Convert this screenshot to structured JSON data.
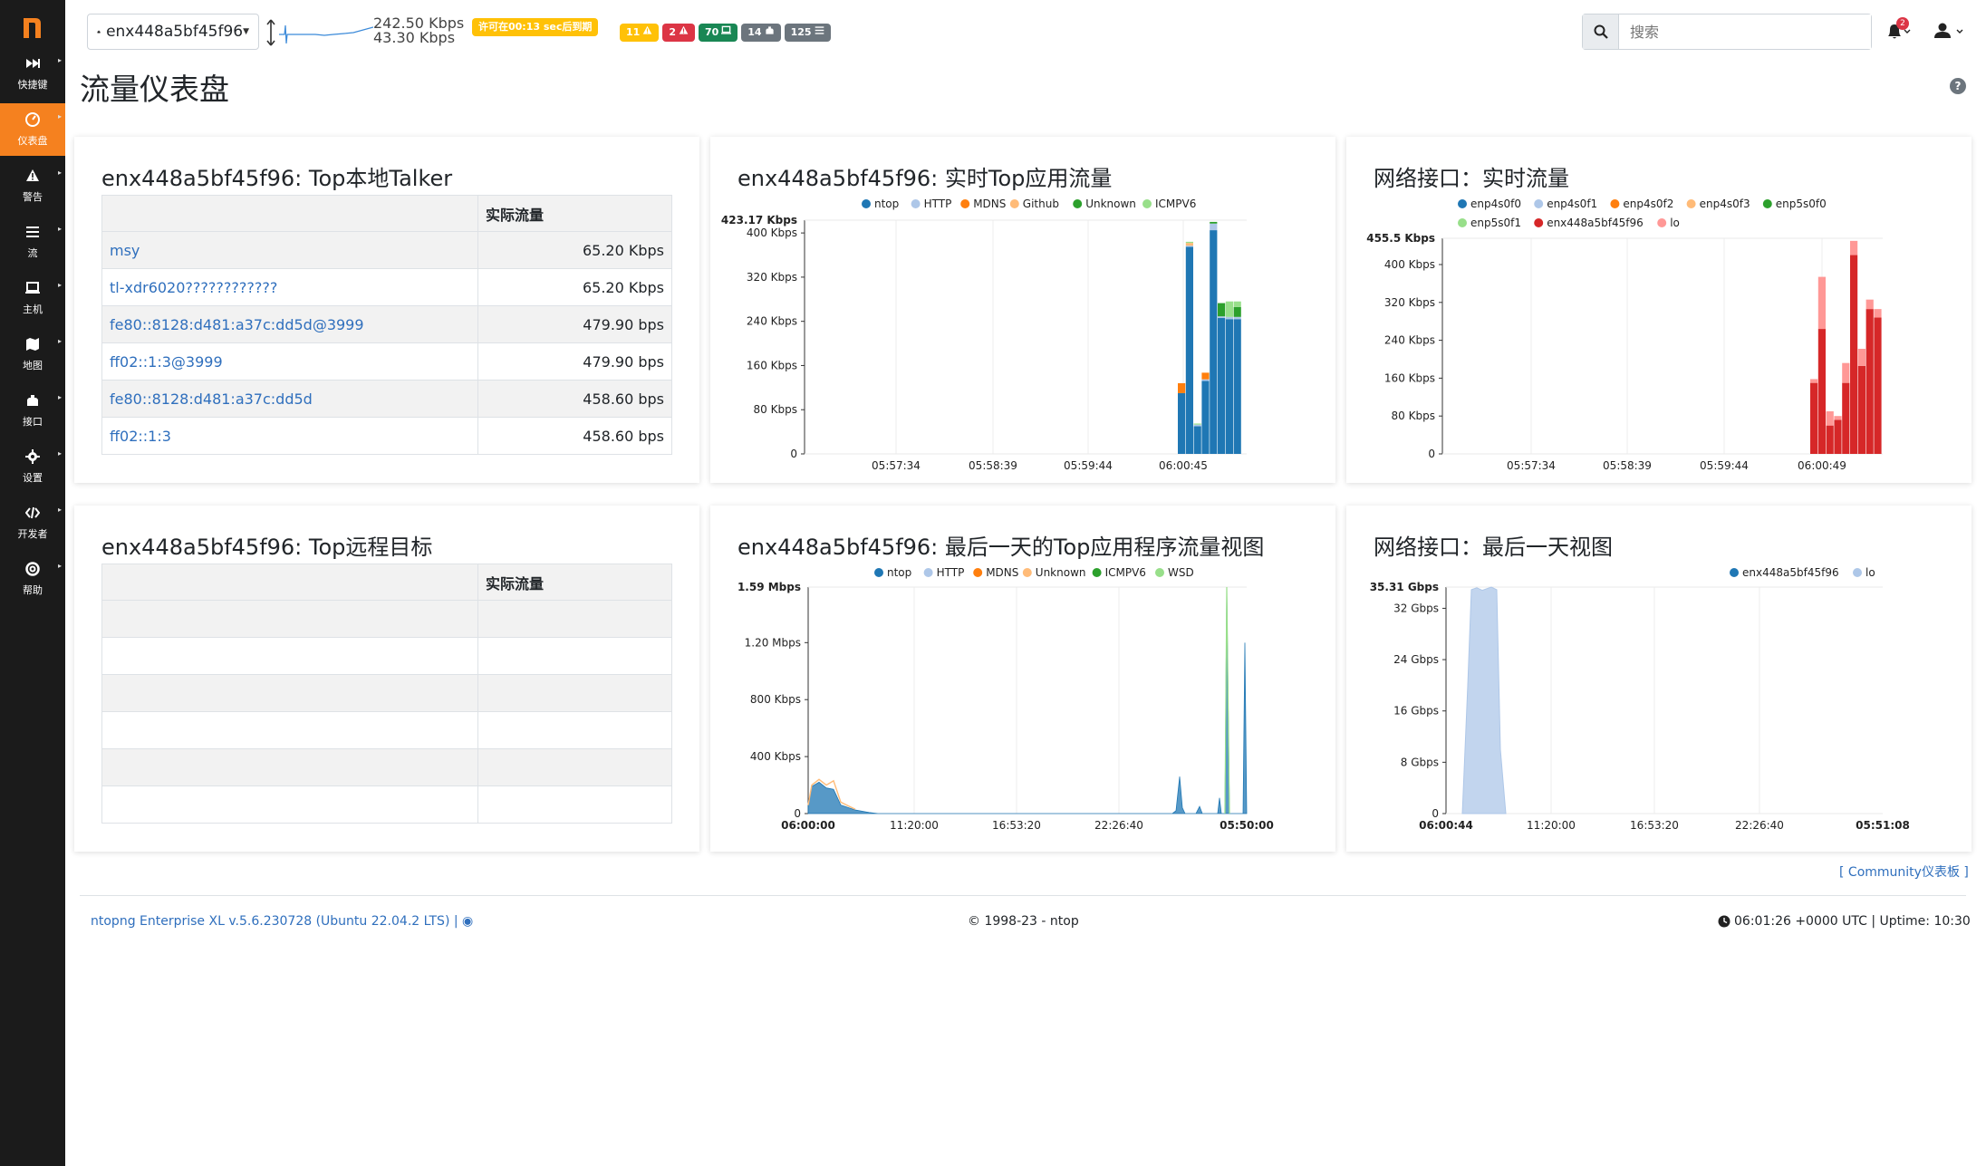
{
  "sidebar": {
    "items": [
      {
        "label": "快捷键",
        "icon": "fast-forward-icon"
      },
      {
        "label": "仪表盘",
        "icon": "dashboard-gauge-icon"
      },
      {
        "label": "警告",
        "icon": "warning-icon"
      },
      {
        "label": "流",
        "icon": "flows-list-icon"
      },
      {
        "label": "主机",
        "icon": "laptop-icon"
      },
      {
        "label": "地图",
        "icon": "map-icon"
      },
      {
        "label": "接口",
        "icon": "ethernet-icon"
      },
      {
        "label": "设置",
        "icon": "gear-icon"
      },
      {
        "label": "开发者",
        "icon": "code-icon"
      },
      {
        "label": "帮助",
        "icon": "lifebuoy-icon"
      }
    ],
    "active_index": 1
  },
  "topbar": {
    "interface": "enx448a5bf45f96",
    "rate_up": "242.50 Kbps",
    "rate_down": "43.30 Kbps",
    "license_warning": "许可在00:13 sec后到期",
    "badges": [
      {
        "text": "11",
        "icon": "warning-icon",
        "color": "#ffc107"
      },
      {
        "text": "2",
        "icon": "warning-icon",
        "color": "#dc3545"
      },
      {
        "text": "70",
        "icon": "laptop-icon",
        "color": "#198754"
      },
      {
        "text": "14",
        "icon": "ethernet-icon",
        "color": "#6c757d"
      },
      {
        "text": "125",
        "icon": "flows-list-icon",
        "color": "#6c757d"
      }
    ],
    "search_placeholder": "搜索",
    "notifications_count": "2"
  },
  "page": {
    "title": "流量仪表盘"
  },
  "cards": {
    "top_local_talkers": {
      "title": "enx448a5bf45f96: Top本地Talker",
      "column_header": "实际流量",
      "rows": [
        {
          "host": "msy",
          "traffic": "65.20 Kbps"
        },
        {
          "host": "tl-xdr6020????????????",
          "traffic": "65.20 Kbps"
        },
        {
          "host": "fe80::8128:d481:a37c:dd5d@3999",
          "traffic": "479.90 bps"
        },
        {
          "host": "ff02::1:3@3999",
          "traffic": "479.90 bps"
        },
        {
          "host": "fe80::8128:d481:a37c:dd5d",
          "traffic": "458.60 bps"
        },
        {
          "host": "ff02::1:3",
          "traffic": "458.60 bps"
        }
      ]
    },
    "top_remote_targets": {
      "title": "enx448a5bf45f96: Top远程目标",
      "column_header": "实际流量"
    },
    "realtime_apps": {
      "title": "enx448a5bf45f96: 实时Top应用流量"
    },
    "realtime_interfaces": {
      "title": "网络接口：实时流量"
    },
    "day_apps": {
      "title": "enx448a5bf45f96: 最后一天的Top应用程序流量视图"
    },
    "day_interfaces": {
      "title": "网络接口：最后一天视图"
    }
  },
  "chart_data": [
    {
      "id": "realtime_apps",
      "type": "bar",
      "stacked": true,
      "ymax_label": "423.17 Kbps",
      "yticks": [
        "0",
        "80 Kbps",
        "160 Kbps",
        "240 Kbps",
        "320 Kbps",
        "400 Kbps"
      ],
      "ytick_values": [
        0,
        80,
        160,
        240,
        320,
        400
      ],
      "ymax": 423.17,
      "xticks": [
        "05:57:34",
        "05:58:39",
        "05:59:44",
        "06:00:45"
      ],
      "xtick_positions": [
        3,
        8,
        13,
        18
      ],
      "n_slots": 24,
      "series": [
        {
          "name": "ntop",
          "color": "#1f77b4",
          "values": [
            0,
            0,
            0,
            0,
            0,
            0,
            0,
            0,
            0,
            0,
            0,
            0,
            0,
            0,
            0,
            0,
            0,
            0,
            110,
            375,
            50,
            0,
            132,
            405
          ]
        },
        {
          "name": "HTTP",
          "color": "#aec7e8",
          "values": [
            0,
            0,
            0,
            0,
            0,
            0,
            0,
            0,
            0,
            0,
            0,
            0,
            0,
            0,
            0,
            0,
            0,
            0,
            0,
            2,
            3,
            0,
            3,
            12
          ]
        },
        {
          "name": "MDNS",
          "color": "#ff7f0e",
          "values": [
            0,
            0,
            0,
            0,
            0,
            0,
            0,
            0,
            0,
            0,
            0,
            0,
            0,
            0,
            0,
            0,
            0,
            0,
            18,
            0,
            0,
            0,
            12,
            0
          ]
        },
        {
          "name": "Github",
          "color": "#ffbb78",
          "values": [
            0,
            0,
            0,
            0,
            0,
            0,
            0,
            0,
            0,
            0,
            0,
            0,
            0,
            0,
            0,
            0,
            0,
            0,
            0,
            5,
            0,
            0,
            0,
            0
          ]
        },
        {
          "name": "Unknown",
          "color": "#2ca02c",
          "values": [
            0,
            0,
            0,
            0,
            0,
            0,
            0,
            0,
            0,
            0,
            0,
            0,
            0,
            0,
            0,
            0,
            0,
            0,
            0,
            0,
            0,
            0,
            0,
            3
          ]
        },
        {
          "name": "ICMPV6",
          "color": "#98df8a",
          "values": [
            0,
            0,
            0,
            0,
            0,
            0,
            0,
            0,
            0,
            0,
            0,
            0,
            0,
            0,
            0,
            0,
            0,
            0,
            0,
            2,
            2,
            0,
            0,
            0
          ]
        }
      ],
      "tail_values_after_last": [
        [
          246,
          3,
          0,
          0,
          24,
          0
        ],
        [
          244,
          4,
          0,
          0,
          0,
          28
        ],
        [
          244,
          4,
          0,
          0,
          18,
          10
        ]
      ]
    },
    {
      "id": "realtime_interfaces",
      "type": "bar",
      "stacked": true,
      "ymax_label": "455.5 Kbps",
      "yticks": [
        "0",
        "80 Kbps",
        "160 Kbps",
        "240 Kbps",
        "320 Kbps",
        "400 Kbps"
      ],
      "ytick_values": [
        0,
        80,
        160,
        240,
        320,
        400
      ],
      "ymax": 455.5,
      "xticks": [
        "05:57:34",
        "05:58:39",
        "05:59:44",
        "06:00:49"
      ],
      "series": [
        {
          "name": "enp4s0f0",
          "color": "#1f77b4"
        },
        {
          "name": "enp4s0f1",
          "color": "#aec7e8"
        },
        {
          "name": "enp4s0f2",
          "color": "#ff7f0e"
        },
        {
          "name": "enp4s0f3",
          "color": "#ffbb78"
        },
        {
          "name": "enp5s0f0",
          "color": "#2ca02c"
        },
        {
          "name": "enp5s0f1",
          "color": "#98df8a"
        },
        {
          "name": "enx448a5bf45f96",
          "color": "#d62728",
          "values": [
            150,
            264,
            60,
            72,
            150,
            420,
            186,
            306,
            288
          ]
        },
        {
          "name": "lo",
          "color": "#ff9896",
          "values": [
            8,
            110,
            30,
            8,
            42,
            30,
            36,
            20,
            18
          ]
        }
      ]
    },
    {
      "id": "day_apps",
      "type": "area",
      "stacked": true,
      "ymax_label": "1.59 Mbps",
      "yticks": [
        "0",
        "400 Kbps",
        "800 Kbps",
        "1.20 Mbps"
      ],
      "ytick_values": [
        0,
        400,
        800,
        1200
      ],
      "ymax": 1590,
      "xticks": [
        "06:00:00",
        "11:20:00",
        "16:53:20",
        "22:26:40",
        "05:50:00"
      ],
      "series": [
        {
          "name": "ntop",
          "color": "#1f77b4"
        },
        {
          "name": "HTTP",
          "color": "#aec7e8"
        },
        {
          "name": "MDNS",
          "color": "#ff7f0e"
        },
        {
          "name": "Unknown",
          "color": "#ffbb78"
        },
        {
          "name": "ICMPV6",
          "color": "#2ca02c"
        },
        {
          "name": "WSD",
          "color": "#98df8a"
        }
      ]
    },
    {
      "id": "day_interfaces",
      "type": "area",
      "ymax_label": "35.31 Gbps",
      "yticks": [
        "0",
        "8 Gbps",
        "16 Gbps",
        "24 Gbps",
        "32 Gbps"
      ],
      "ytick_values": [
        0,
        8,
        16,
        24,
        32
      ],
      "ymax": 35.31,
      "xticks": [
        "06:00:44",
        "11:20:00",
        "16:53:20",
        "22:26:40",
        "05:51:08"
      ],
      "series": [
        {
          "name": "enx448a5bf45f96",
          "color": "#1f77b4"
        },
        {
          "name": "lo",
          "color": "#aec7e8"
        }
      ]
    }
  ],
  "footer": {
    "community_link": "[ Community仪表板 ]",
    "version": "ntopng Enterprise XL v.5.6.230728 (Ubuntu 22.04.2 LTS) |",
    "copyright": "© 1998-23 - ntop",
    "clock": "06:01:26 +0000 UTC | Uptime: 10:30"
  }
}
